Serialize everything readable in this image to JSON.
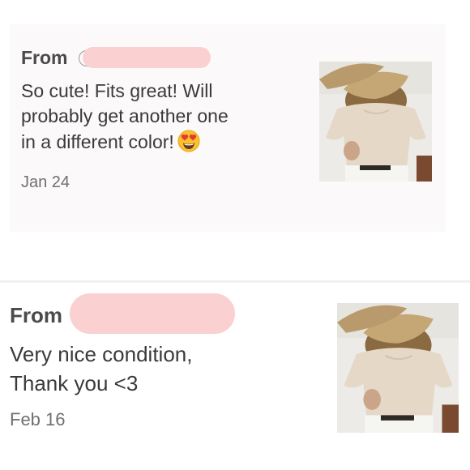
{
  "reviews": [
    {
      "from_label": "From",
      "text_lines": [
        "So cute! Fits great! Will",
        "probably get another one",
        "in a different color!"
      ],
      "emoji": "heart-eyes-emoji",
      "date": "Jan 24",
      "photo": "product-photo-beige-top"
    },
    {
      "from_label": "From",
      "text_lines": [
        "Very nice condition,",
        "Thank you <3"
      ],
      "date": "Feb 16",
      "photo": "product-photo-beige-top"
    }
  ],
  "colors": {
    "redaction": "#fbd0d0",
    "card_bg": "#fbf9f9",
    "top_color": "#e6d8c6",
    "hat_color": "#b99a6c"
  }
}
